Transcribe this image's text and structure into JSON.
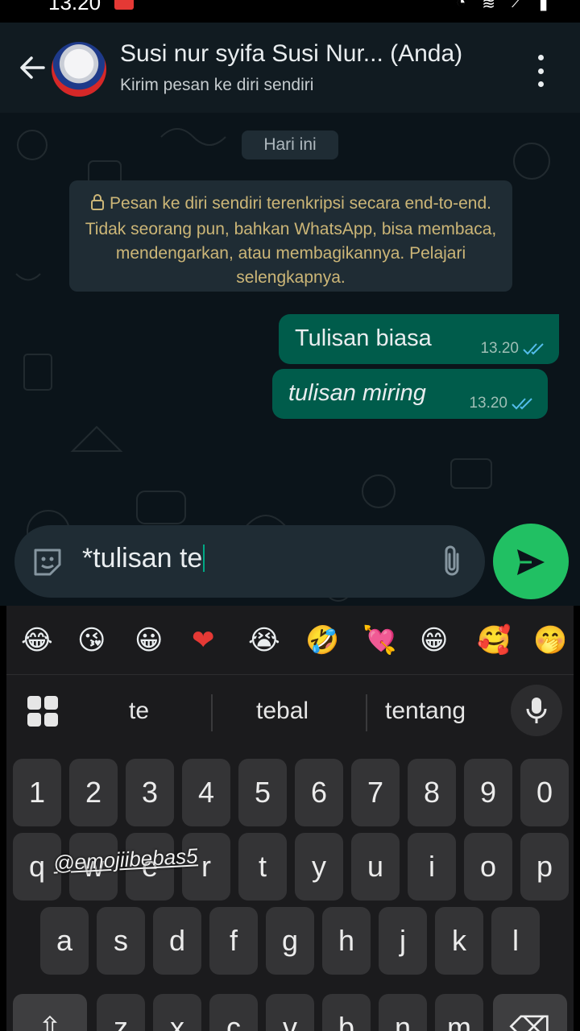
{
  "status_bar": {
    "time": "13.20"
  },
  "header": {
    "title": "Susi nur syifa Susi Nur... (Anda)",
    "subtitle": "Kirim pesan ke diri sendiri"
  },
  "chat": {
    "date_chip": "Hari ini",
    "encryption_notice": "Pesan ke diri sendiri terenkripsi secara end-to-end. Tidak seorang pun, bahkan WhatsApp, bisa membaca, mendengarkan, atau membagikannya. Pelajari selengkapnya.",
    "messages": [
      {
        "text": "Tulisan biasa",
        "time": "13.20",
        "status": "read"
      },
      {
        "text": "tulisan miring",
        "time": "13.20",
        "status": "read",
        "style": "italic"
      }
    ]
  },
  "composer": {
    "value": "*tulisan te"
  },
  "keyboard": {
    "emojis": [
      "😂",
      "😘",
      "😀",
      "❤",
      "😭",
      "🤣",
      "💘",
      "😁",
      "🥰",
      "🤭"
    ],
    "suggestions": [
      "te",
      "tebal",
      "tentang"
    ],
    "number_row": [
      "1",
      "2",
      "3",
      "4",
      "5",
      "6",
      "7",
      "8",
      "9",
      "0"
    ],
    "row1": [
      "q",
      "w",
      "e",
      "r",
      "t",
      "y",
      "u",
      "i",
      "o",
      "p"
    ],
    "row2": [
      "a",
      "s",
      "d",
      "f",
      "g",
      "h",
      "j",
      "k",
      "l"
    ],
    "row3": [
      "z",
      "x",
      "c",
      "v",
      "b",
      "n",
      "m"
    ]
  },
  "watermark": "@emojiibebas5",
  "colors": {
    "header_bg": "#111b21",
    "chat_bg": "#0b141a",
    "outgoing_bubble": "#005c4b",
    "send_button": "#21c063",
    "read_ticks": "#53bdeb",
    "notice_text": "#ccb677",
    "keyboard_bg": "#1b1b1d",
    "key_bg": "#343436"
  }
}
